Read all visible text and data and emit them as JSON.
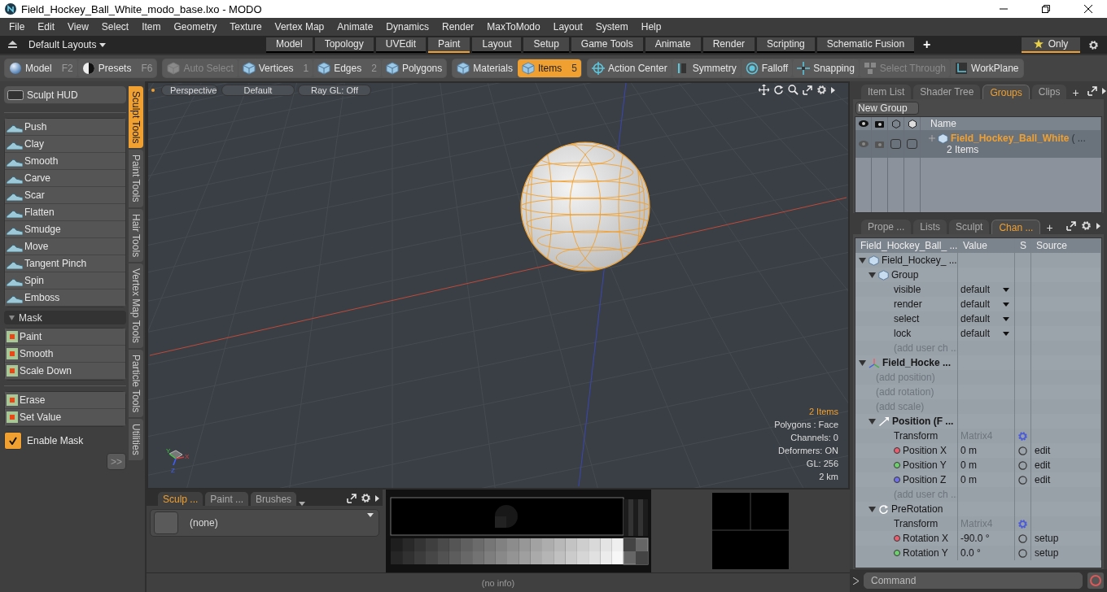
{
  "window": {
    "title": "Field_Hockey_Ball_White_modo_base.lxo - MODO"
  },
  "menu": [
    "File",
    "Edit",
    "View",
    "Select",
    "Item",
    "Geometry",
    "Texture",
    "Vertex Map",
    "Animate",
    "Dynamics",
    "Render",
    "MaxToModo",
    "Layout",
    "System",
    "Help"
  ],
  "layout_bar": {
    "layouts": "Default Layouts",
    "tabs": [
      {
        "label": "Model",
        "selected": false
      },
      {
        "label": "Topology",
        "selected": false
      },
      {
        "label": "UVEdit",
        "selected": false
      },
      {
        "label": "Paint",
        "selected": true
      },
      {
        "label": "Layout",
        "selected": false
      },
      {
        "label": "Setup",
        "selected": false
      },
      {
        "label": "Game Tools",
        "selected": false
      },
      {
        "label": "Animate",
        "selected": false
      },
      {
        "label": "Render",
        "selected": false
      },
      {
        "label": "Scripting",
        "selected": false
      },
      {
        "label": "Schematic Fusion",
        "selected": false
      }
    ],
    "add": "+",
    "only": "Only"
  },
  "toolbar": [
    {
      "buttons": [
        {
          "label": "Model",
          "shortcut": "F2",
          "disabled": false,
          "selected": false
        },
        {
          "label": "Presets",
          "shortcut": "F6",
          "disabled": false,
          "selected": false
        }
      ]
    },
    {
      "buttons": [
        {
          "label": "Auto Select",
          "disabled": true,
          "selected": false
        },
        {
          "label": "Vertices",
          "shortcut": "1",
          "disabled": false,
          "selected": false
        },
        {
          "label": "Edges",
          "shortcut": "2",
          "disabled": false,
          "selected": false
        },
        {
          "label": "Polygons",
          "disabled": false,
          "selected": false
        }
      ]
    },
    {
      "buttons": [
        {
          "label": "Materials",
          "disabled": false,
          "selected": false
        },
        {
          "label": "Items",
          "shortcut": "5",
          "disabled": false,
          "selected": true
        }
      ]
    },
    {
      "buttons": [
        {
          "label": "Action Center",
          "disabled": false,
          "selected": false
        },
        {
          "label": "Symmetry",
          "disabled": false,
          "selected": false
        },
        {
          "label": "Falloff",
          "disabled": false,
          "selected": false
        },
        {
          "label": "Snapping",
          "disabled": false,
          "selected": false
        },
        {
          "label": "Select Through",
          "disabled": true,
          "selected": false
        },
        {
          "label": "WorkPlane",
          "disabled": false,
          "selected": false
        }
      ]
    }
  ],
  "left_panel": {
    "hud": "Sculpt HUD",
    "tools": [
      "Push",
      "Clay",
      "Smooth",
      "Carve",
      "Scar",
      "Flatten",
      "Smudge",
      "Move",
      "Tangent Pinch",
      "Spin",
      "Emboss"
    ],
    "mask": {
      "label": "Mask",
      "expanded": true,
      "tools": [
        "Paint",
        "Smooth",
        "Scale Down"
      ]
    },
    "mask_tools": [
      "Erase",
      "Set Value"
    ],
    "enable_mask": {
      "label": "Enable Mask",
      "checked": true
    },
    "more": ">>",
    "vertical_tabs": [
      {
        "label": "Sculpt Tools",
        "selected": true
      },
      {
        "label": "Paint Tools",
        "selected": false
      },
      {
        "label": "Hair Tools",
        "selected": false
      },
      {
        "label": "Vertex Map Tools",
        "selected": false
      },
      {
        "label": "Particle Tools",
        "selected": false
      },
      {
        "label": "Utilities",
        "selected": false
      }
    ]
  },
  "viewport": {
    "view": "Perspective",
    "shading": "Default",
    "raygl": "Ray GL: Off",
    "items_count": "2 Items",
    "info": [
      "Polygons : Face",
      "Channels: 0",
      "Deformers: ON",
      "GL: 256",
      "2 km"
    ],
    "axes": [
      "X",
      "Y",
      "Z"
    ]
  },
  "brush_panel": {
    "tabs": [
      {
        "label": "Sculp ...",
        "selected": true
      },
      {
        "label": "Paint ...",
        "selected": false
      },
      {
        "label": "Brushes",
        "selected": false
      }
    ],
    "preset": "(none)"
  },
  "status_bar": "(no info)",
  "groups_panel": {
    "tabs": [
      {
        "label": "Item List",
        "selected": false
      },
      {
        "label": "Shader Tree",
        "selected": false
      },
      {
        "label": "Groups",
        "selected": true
      },
      {
        "label": "Clips",
        "selected": false
      }
    ],
    "add": "+",
    "new_group": "New Group",
    "name_column": "Name",
    "group": {
      "name": "Field_Hockey_Ball_White",
      "suffix": "( ...",
      "count": "2 Items"
    }
  },
  "channels_panel": {
    "tabs": [
      {
        "label": "Prope ...",
        "selected": false
      },
      {
        "label": "Lists",
        "selected": false
      },
      {
        "label": "Sculpt",
        "selected": false
      },
      {
        "label": "Chan ...",
        "selected": true
      }
    ],
    "add": "+",
    "columns": [
      "Field_Hockey_Ball_ ...",
      "Value",
      "S",
      "Source"
    ],
    "tree": [
      {
        "label": "Field_Hockey_ ...",
        "kind": "mesh",
        "expanded": true,
        "children": [
          {
            "label": "Group",
            "kind": "group",
            "expanded": true,
            "children": [
              {
                "label": "visible",
                "kind": "channel",
                "value": "default",
                "dropdown": true
              },
              {
                "label": "render",
                "kind": "channel",
                "value": "default",
                "dropdown": true
              },
              {
                "label": "select",
                "kind": "channel",
                "value": "default",
                "dropdown": true
              },
              {
                "label": "lock",
                "kind": "channel",
                "value": "default",
                "dropdown": true
              },
              {
                "label": "(add user ch ...",
                "kind": "add"
              }
            ]
          }
        ]
      },
      {
        "label": "Field_Hocke ...",
        "kind": "locator",
        "expanded": true,
        "children": [
          {
            "label": "(add position)",
            "kind": "add"
          },
          {
            "label": "(add rotation)",
            "kind": "add"
          },
          {
            "label": "(add scale)",
            "kind": "add"
          },
          {
            "label": "Position (F ...",
            "kind": "transform",
            "expanded": true,
            "children": [
              {
                "label": "Transform",
                "kind": "matrix",
                "value": "Matrix4"
              },
              {
                "label": "Position X",
                "kind": "channel",
                "color": "#e86070",
                "value": "0 m",
                "source": "edit"
              },
              {
                "label": "Position Y",
                "kind": "channel",
                "color": "#70d070",
                "value": "0 m",
                "source": "edit"
              },
              {
                "label": "Position Z",
                "kind": "channel",
                "color": "#7070e8",
                "value": "0 m",
                "source": "edit"
              },
              {
                "label": "(add user ch ...",
                "kind": "add"
              }
            ]
          },
          {
            "label": "PreRotation",
            "kind": "rotation",
            "expanded": true,
            "children": [
              {
                "label": "Transform",
                "kind": "matrix",
                "value": "Matrix4"
              },
              {
                "label": "Rotation X",
                "kind": "channel",
                "color": "#e86070",
                "value": "-90.0 °",
                "source": "setup"
              },
              {
                "label": "Rotation Y",
                "kind": "channel",
                "color": "#70d070",
                "value": "0.0 °",
                "source": "setup"
              }
            ]
          }
        ]
      }
    ]
  },
  "command": {
    "placeholder": "Command"
  }
}
